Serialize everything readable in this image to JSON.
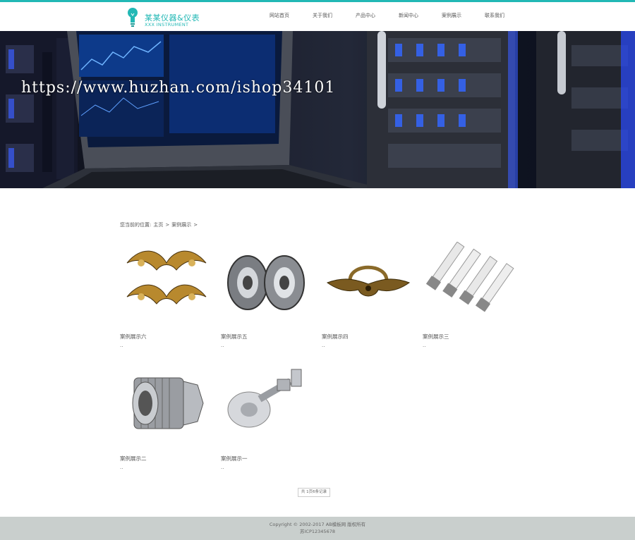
{
  "header": {
    "logo_title": "某某仪器&仪表",
    "logo_subtitle": "XXX INSTRUMENT",
    "accent_color": "#22b8b5",
    "nav": [
      {
        "label": "网站首页"
      },
      {
        "label": "关于我们"
      },
      {
        "label": "产品中心"
      },
      {
        "label": "新闻中心"
      },
      {
        "label": "案例展示"
      },
      {
        "label": "联系我们"
      }
    ]
  },
  "banner": {
    "watermark": "https://www.huzhan.com/ishop34101",
    "image": "server-rack-and-laptop-photo"
  },
  "breadcrumb": {
    "prefix": "您当前的位置:",
    "home": "主页",
    "sep1": ">",
    "current": "案例展示",
    "sep2": ">"
  },
  "cases": [
    {
      "title": "案例展示六",
      "desc": "..",
      "image": "ornamental-brass-scroll"
    },
    {
      "title": "案例展示五",
      "desc": "..",
      "image": "roller-bearings"
    },
    {
      "title": "案例展示四",
      "desc": "..",
      "image": "brass-drawer-handle"
    },
    {
      "title": "案例展示三",
      "desc": "..",
      "image": "spark-plugs"
    },
    {
      "title": "案例展示二",
      "desc": "..",
      "image": "threaded-pipe-fitting"
    },
    {
      "title": "案例展示一",
      "desc": "..",
      "image": "glass-clamp-fitting"
    }
  ],
  "pagination": {
    "label": "共 1页6条记录"
  },
  "footer": {
    "copyright": "Copyright © 2002-2017 AB模板网 版权所有",
    "icp": "苏ICP12345678"
  }
}
